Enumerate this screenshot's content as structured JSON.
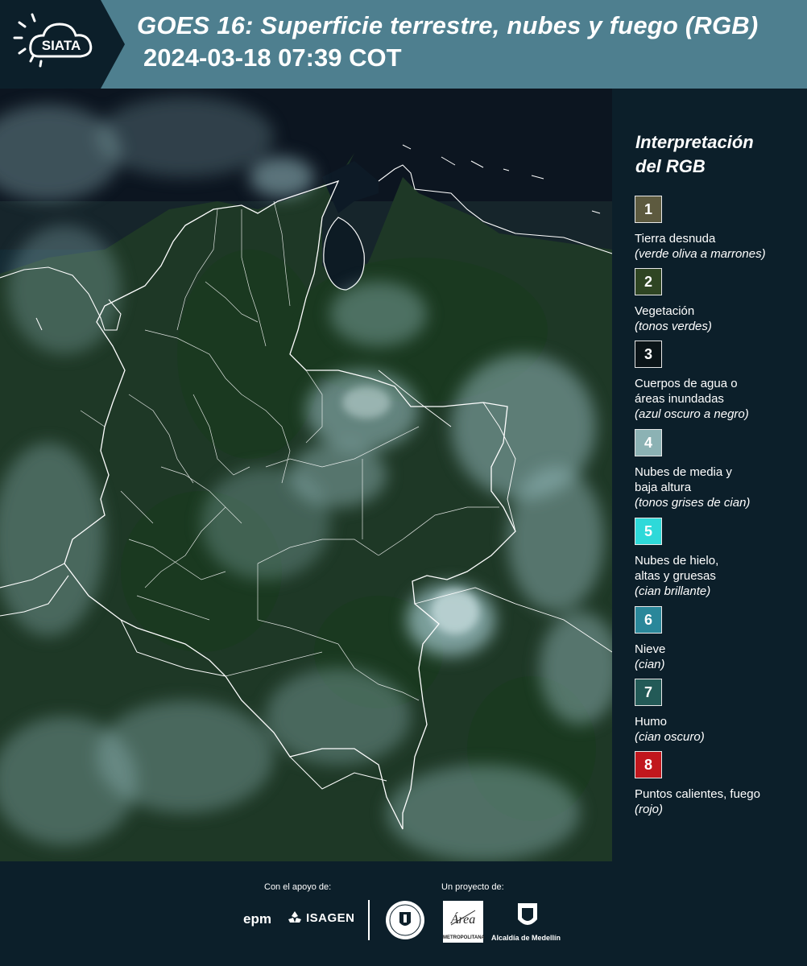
{
  "header": {
    "logo_text": "SIATA",
    "title_line1": "GOES 16: Superficie terrestre, nubes y fuego (RGB)",
    "title_line2": "2024-03-18 07:39 COT"
  },
  "legend": {
    "title_line1": "Interpretación",
    "title_line2": "del RGB",
    "items": [
      {
        "number": "1",
        "color": "#5d5a3f",
        "label": "Tierra desnuda",
        "label2": "",
        "note": "(verde oliva a marrones)"
      },
      {
        "number": "2",
        "color": "#2f4523",
        "label": "Vegetación",
        "label2": "",
        "note": "(tonos verdes)"
      },
      {
        "number": "3",
        "color": "#0b1418",
        "label": "Cuerpos de agua o",
        "label2": "áreas inundadas",
        "note": "(azul oscuro a negro)"
      },
      {
        "number": "4",
        "color": "#8cb2b4",
        "label": "Nubes de media y",
        "label2": "baja altura",
        "note": "(tonos grises de cian)"
      },
      {
        "number": "5",
        "color": "#2ed9d9",
        "label": "Nubes de hielo,",
        "label2": "altas y gruesas",
        "note": "(cian brillante)"
      },
      {
        "number": "6",
        "color": "#2a879a",
        "label": "Nieve",
        "label2": "",
        "note": "(cian)"
      },
      {
        "number": "7",
        "color": "#235a57",
        "label": "Humo",
        "label2": "",
        "note": "(cian oscuro)"
      },
      {
        "number": "8",
        "color": "#c1171d",
        "label": "Puntos calientes, fuego",
        "label2": "",
        "note": "(rojo)"
      }
    ]
  },
  "footer": {
    "support_label": "Con el apoyo de:",
    "project_label": "Un proyecto de:",
    "epm": "epm",
    "isagen": "ISAGEN",
    "amva_text": "Área",
    "amva_name": "METROPOLITANA",
    "alcaldia": "Alcaldía de Medellín"
  },
  "map": {
    "colors": {
      "land": "#1f3a26",
      "ocean": "#0e1a20",
      "cloud": "#9cc2c6",
      "border": "#ffffff"
    }
  }
}
